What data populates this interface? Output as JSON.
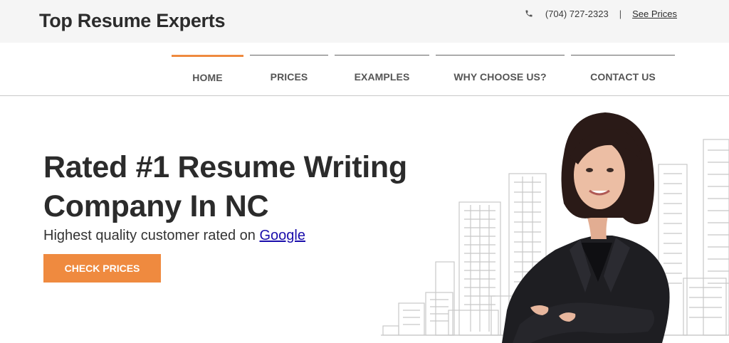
{
  "header": {
    "brand": "Top Resume Experts",
    "phone": "(704) 727-2323",
    "separator": "|",
    "see_prices": "See Prices",
    "phone_icon": "phone-icon"
  },
  "nav": {
    "items": [
      {
        "label": "HOME",
        "active": true
      },
      {
        "label": "PRICES",
        "active": false
      },
      {
        "label": "EXAMPLES",
        "active": false
      },
      {
        "label": "WHY CHOOSE US?",
        "active": false
      },
      {
        "label": "CONTACT US",
        "active": false
      }
    ]
  },
  "hero": {
    "headline_line1": "Rated #1 Resume Writing",
    "headline_line2": "Company In NC",
    "sub_prefix": "Highest quality customer rated on",
    "sub_link": "Google",
    "cta": "CHECK PRICES"
  },
  "colors": {
    "accent": "#ef8a3f",
    "link": "#1a0dab",
    "topbar_bg": "#f5f5f5"
  }
}
